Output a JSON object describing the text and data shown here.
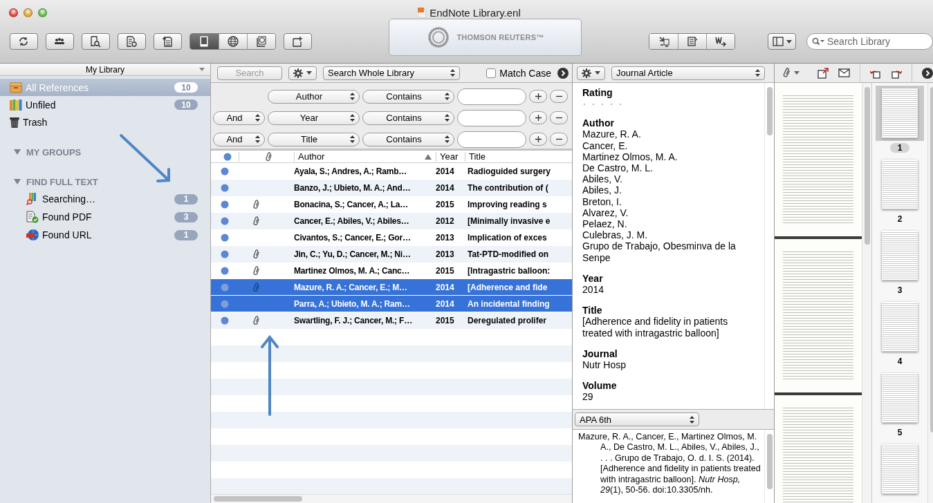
{
  "window": {
    "title": "EndNote Library.enl"
  },
  "toolbar": {
    "view_modes": [
      {
        "selected": true
      },
      {
        "selected": false
      },
      {
        "selected": false
      }
    ],
    "logo": "THOMSON REUTERS™",
    "search": {
      "placeholder": "Search Library"
    }
  },
  "sidebar": {
    "header": "My Library",
    "library": [
      {
        "label": "All References",
        "count": "10",
        "selected": true
      },
      {
        "label": "Unfiled",
        "count": "10",
        "selected": false
      },
      {
        "label": "Trash",
        "selected": false
      }
    ],
    "groups": [
      {
        "label": "MY GROUPS",
        "expanded": true
      },
      {
        "label": "FIND FULL TEXT",
        "expanded": true,
        "items": [
          {
            "label": "Searching…",
            "count": "1",
            "selected": false
          },
          {
            "label": "Found PDF",
            "count": "3",
            "selected": false
          },
          {
            "label": "Found URL",
            "count": "1",
            "selected": false
          }
        ]
      }
    ]
  },
  "search": {
    "button": "Search",
    "scope": "Search Whole Library",
    "match_case": {
      "label": "Match Case",
      "checked": false
    },
    "rows": [
      {
        "field": "Author",
        "operator": "Contains"
      },
      {
        "connector": "And",
        "field": "Year",
        "operator": "Contains"
      },
      {
        "connector": "And",
        "field": "Title",
        "operator": "Contains"
      }
    ]
  },
  "table": {
    "columns": [
      {
        "label": "Author",
        "sorted": true
      },
      {
        "label": "Year",
        "sorted": false
      },
      {
        "label": "Title",
        "sorted": false
      }
    ],
    "rows": [
      {
        "author": "Ayala, S.; Andres, A.; Ramb…",
        "year": "2014",
        "title": "Radioguided surgery",
        "attachment": false,
        "selected": false
      },
      {
        "author": "Banzo, J.; Ubieto, M. A.; And…",
        "year": "2014",
        "title": "The contribution of (",
        "attachment": false,
        "selected": false
      },
      {
        "author": "Bonacina, S.; Cancer, A.; La…",
        "year": "2015",
        "title": "Improving reading s",
        "attachment": true,
        "selected": false
      },
      {
        "author": "Cancer, E.; Abiles, V.; Abiles…",
        "year": "2012",
        "title": "[Minimally invasive e",
        "attachment": true,
        "selected": false
      },
      {
        "author": "Civantos, S.; Cancer, E.; Gor…",
        "year": "2013",
        "title": "Implication of exces",
        "attachment": false,
        "selected": false
      },
      {
        "author": "Jin, C.; Yu, D.; Cancer, M.; Ni…",
        "year": "2013",
        "title": "Tat-PTD-modified on",
        "attachment": true,
        "selected": false
      },
      {
        "author": "Martinez Olmos, M. A.; Canc…",
        "year": "2015",
        "title": "[Intragastric balloon:",
        "attachment": true,
        "selected": false
      },
      {
        "author": "Mazure, R. A.; Cancer, E.; M…",
        "year": "2014",
        "title": "[Adherence and fide",
        "attachment": true,
        "selected": true
      },
      {
        "author": "Parra, A.; Ubieto, M. A.; Ram…",
        "year": "2014",
        "title": "An incidental finding",
        "attachment": false,
        "selected": true
      },
      {
        "author": "Swartling, F. J.; Cancer, M.; F…",
        "year": "2015",
        "title": "Deregulated prolifer",
        "attachment": true,
        "selected": false
      }
    ]
  },
  "reference": {
    "type": "Journal Article",
    "rating": {
      "label": "Rating",
      "stars": 0
    },
    "fields": [
      {
        "label": "Author",
        "lines": [
          "Mazure, R. A.",
          "Cancer, E.",
          "Martinez Olmos, M. A.",
          "De Castro, M. L.",
          "Abiles, V.",
          "Abiles, J.",
          "Breton, I.",
          "Alvarez, V.",
          "Pelaez, N.",
          "Culebras, J. M.",
          "Grupo de Trabajo, Obesminva de la Senpe"
        ]
      },
      {
        "label": "Year",
        "lines": [
          "2014"
        ]
      },
      {
        "label": "Title",
        "lines": [
          "[Adherence and fidelity in patients treated with intragastric balloon]"
        ]
      },
      {
        "label": "Journal",
        "lines": [
          "Nutr Hosp"
        ]
      },
      {
        "label": "Volume",
        "lines": [
          "29"
        ]
      }
    ],
    "style": "APA 6th",
    "citation": "Mazure, R. A., Cancer, E., Martinez Olmos, M. A., De Castro, M. L., Abiles, V., Abiles, J., . . . Grupo de Trabajo, O. d. I. S. (2014). [Adherence and fidelity in patients treated with intragastric balloon]. *Nutr Hosp, 29*(1), 50-56. doi:10.3305/nh."
  },
  "pdf": {
    "thumbnails": [
      {
        "number": "1",
        "selected": true
      },
      {
        "number": "2",
        "selected": false
      },
      {
        "number": "3",
        "selected": false
      },
      {
        "number": "4",
        "selected": false
      },
      {
        "number": "5",
        "selected": false
      },
      {
        "selected": false
      }
    ]
  }
}
